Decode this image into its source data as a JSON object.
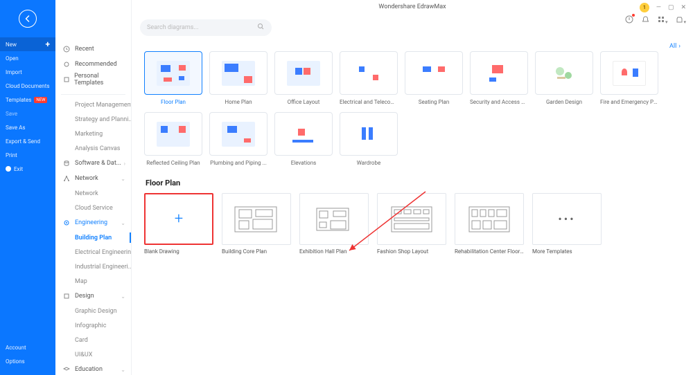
{
  "app_title": "Wondershare EdrawMax",
  "avatar_text": "1",
  "search": {
    "placeholder": "Search diagrams..."
  },
  "rail": {
    "new": "New",
    "open": "Open",
    "import": "Import",
    "cloud": "Cloud Documents",
    "templates": "Templates",
    "templates_badge": "NEW",
    "save": "Save",
    "save_as": "Save As",
    "export": "Export & Send",
    "print": "Print",
    "exit": "Exit",
    "account": "Account",
    "options": "Options"
  },
  "categories": {
    "recent": "Recent",
    "recommended": "Recommended",
    "personal": "Personal Templates",
    "project_mgmt": "Project Management",
    "strategy": "Strategy and Planni...",
    "marketing": "Marketing",
    "analysis": "Analysis Canvas",
    "software": "Software & Dat...",
    "network": "Network",
    "network_sub": "Network",
    "cloud_service": "Cloud Service",
    "engineering": "Engineering",
    "building_plan": "Building Plan",
    "elec_eng": "Electrical Engineering",
    "ind_eng": "Industrial Engineeri...",
    "map": "Map",
    "design": "Design",
    "graphic": "Graphic Design",
    "infographic": "Infographic",
    "card": "Card",
    "uiux": "UI&UX",
    "education": "Education"
  },
  "all_link": "All",
  "cards_row1": [
    "Floor Plan",
    "Home Plan",
    "Office Layout",
    "Electrical and Telecom...",
    "Seating Plan",
    "Security and Access Pl...",
    "Garden Design",
    "Fire and Emergency Pl..."
  ],
  "cards_row2": [
    "Reflected Ceiling Plan",
    "Plumbing and Piping ...",
    "Elevations",
    "Wardrobe"
  ],
  "section_title": "Floor Plan",
  "templates": [
    "Blank Drawing",
    "Building Core Plan",
    "Exhibition Hall Plan",
    "Fashion Shop Layout",
    "Rehabilitation Center Floor Pl...",
    "More Templates"
  ]
}
